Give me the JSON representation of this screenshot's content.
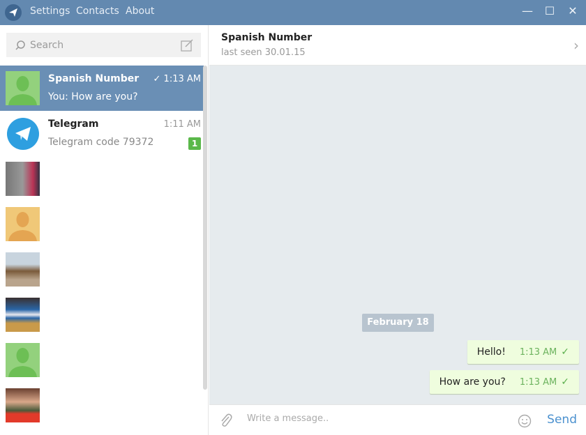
{
  "titlebar": {
    "menu": [
      "Settings",
      "Contacts",
      "About"
    ],
    "minimize": "—",
    "maximize": "☐",
    "close": "✕"
  },
  "search": {
    "placeholder": "Search"
  },
  "chats": [
    {
      "name": "Spanish Number",
      "preview": "You: How are you?",
      "time": "✓ 1:13 AM",
      "selected": true
    },
    {
      "name": "Telegram",
      "preview": "Telegram code 79372",
      "time": "1:11 AM",
      "badge": "1"
    }
  ],
  "conversation": {
    "title": "Spanish Number",
    "status": "last seen 30.01.15",
    "date_label": "February 18",
    "messages": [
      {
        "text": "Hello!",
        "time": "1:13 AM"
      },
      {
        "text": "How are you?",
        "time": "1:13 AM"
      }
    ]
  },
  "composer": {
    "placeholder": "Write a message..",
    "send": "Send"
  },
  "colors": {
    "titlebar": "#6389b0",
    "selected": "#6a8fb5",
    "bubble": "#effdde",
    "send": "#4b91cf"
  }
}
